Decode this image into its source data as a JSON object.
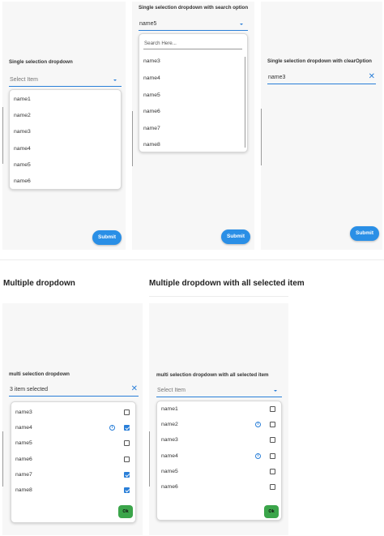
{
  "panel1": {
    "label": "Single selection dropdown",
    "placeholder": "Select Item",
    "items": [
      "name1",
      "name2",
      "name3",
      "name4",
      "name5",
      "name6"
    ],
    "submit": "Submit"
  },
  "panel2": {
    "label": "Single selection dropdown with search option",
    "value": "name5",
    "search_placeholder": "Search Here...",
    "items": [
      "name3",
      "name4",
      "name5",
      "name6",
      "name7",
      "name8"
    ],
    "submit": "Submit"
  },
  "panel3": {
    "label": "Single selection dropdown with clearOption",
    "value": "name3",
    "submit": "Submit"
  },
  "headings": {
    "multiple": "Multiple dropdown",
    "multiple_all": "Multiple dropdown with all selected item"
  },
  "panel4": {
    "label": "multi selection dropdown",
    "value": "3 item selected",
    "items": [
      {
        "name": "name3",
        "info": false,
        "checked": false
      },
      {
        "name": "name4",
        "info": true,
        "checked": true
      },
      {
        "name": "name5",
        "info": false,
        "checked": false
      },
      {
        "name": "name6",
        "info": false,
        "checked": false
      },
      {
        "name": "name7",
        "info": false,
        "checked": true
      },
      {
        "name": "name8",
        "info": false,
        "checked": true
      }
    ],
    "ok": "Ok"
  },
  "panel5": {
    "label": "multi selection dropdown with all selected item",
    "placeholder": "Select Item",
    "items": [
      {
        "name": "name1",
        "info": false,
        "checked": false
      },
      {
        "name": "name2",
        "info": true,
        "checked": false
      },
      {
        "name": "name3",
        "info": false,
        "checked": false
      },
      {
        "name": "name4",
        "info": true,
        "checked": false
      },
      {
        "name": "name5",
        "info": false,
        "checked": false
      },
      {
        "name": "name6",
        "info": false,
        "checked": false
      }
    ],
    "ok": "Ok"
  },
  "colors": {
    "accent": "#2a7fd8",
    "submit": "#2a8fe6",
    "ok": "#3ba54a",
    "panel": "#f7f7f7"
  },
  "icons": {
    "caret": "chevron-down-icon",
    "clear": "close-icon",
    "info": "info-icon",
    "check": "checkbox-icon"
  }
}
